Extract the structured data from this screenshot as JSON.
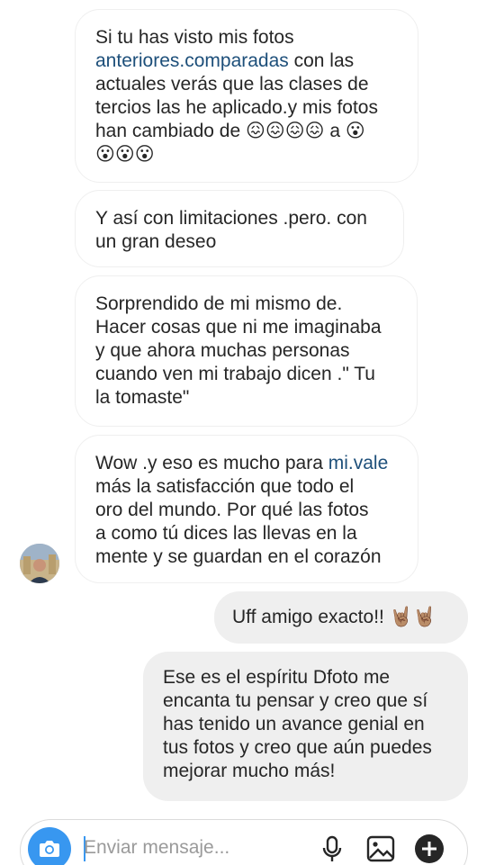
{
  "messages": [
    {
      "direction": "incoming",
      "parts": [
        "Si tu has visto mis fotos\n",
        "anteriores.comparadas",
        " con las\nactuales verás que las clases de\ntercios las he aplicado.y mis fotos\nhan cambiado de ",
        "😖😖😖😖",
        " a ",
        "😮",
        "\n",
        "😮😮😮"
      ]
    },
    {
      "direction": "incoming",
      "text": "Y así con limitaciones .pero. con\nun gran deseo"
    },
    {
      "direction": "incoming",
      "text": "Sorprendido de mi mismo de.\nHacer cosas que ni me imaginaba\ny que ahora muchas personas\ncuando ven mi trabajo dicen .\" Tu\nla tomaste\""
    },
    {
      "direction": "incoming",
      "parts": [
        "Wow .y eso es mucho para ",
        "mi.vale",
        "\nmás la satisfacción que todo el\noro del mundo. Por qué las fotos\na como tú dices las llevas en la\nmente y se guardan en el corazón"
      ]
    },
    {
      "direction": "outgoing",
      "parts": [
        "Uff amigo exacto!! ",
        "🤘🏽🤘🏽"
      ]
    },
    {
      "direction": "outgoing",
      "text": "Ese es el espíritu Dfoto me\nencanta tu pensar y creo que sí\nhas tenido un avance genial en\ntus fotos y creo que aún puedes\nmejorar mucho más!"
    }
  ],
  "composer": {
    "placeholder": "Enviar mensaje...",
    "value": ""
  },
  "icons": {
    "camera": "camera-icon",
    "microphone": "microphone-icon",
    "gallery": "gallery-icon",
    "add": "plus-circle-icon"
  },
  "colors": {
    "accent": "#3897f0",
    "link": "#1d4f7a",
    "outgoing_bubble": "#efefef",
    "text": "#262626"
  }
}
